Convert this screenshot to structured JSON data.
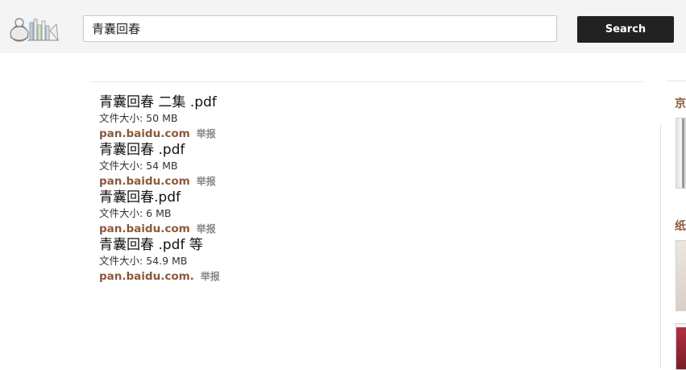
{
  "header": {
    "search_value": "青囊回春",
    "search_button": "Search",
    "logo_icon": "books-and-teapot-logo"
  },
  "results": [
    {
      "title": "青囊回春 二集 .pdf",
      "size": "文件大小: 50 MB",
      "source": "pan.baidu.com",
      "report": "举报"
    },
    {
      "title": "青囊回春 .pdf",
      "size": "文件大小: 54 MB",
      "source": "pan.baidu.com",
      "report": "举报"
    },
    {
      "title": "青囊回春.pdf",
      "size": "文件大小: 6 MB",
      "source": "pan.baidu.com",
      "report": "举报"
    },
    {
      "title": "青囊回春 .pdf 等",
      "size": "文件大小: 54.9 MB",
      "source": "pan.baidu.com.",
      "report": "举报"
    }
  ],
  "sidebar": {
    "heading_1": "京",
    "heading_2": "纸"
  },
  "colors": {
    "accent_brown": "#8b5a3c",
    "button_dark": "#222222",
    "topbar_bg": "#f4f4f4"
  }
}
